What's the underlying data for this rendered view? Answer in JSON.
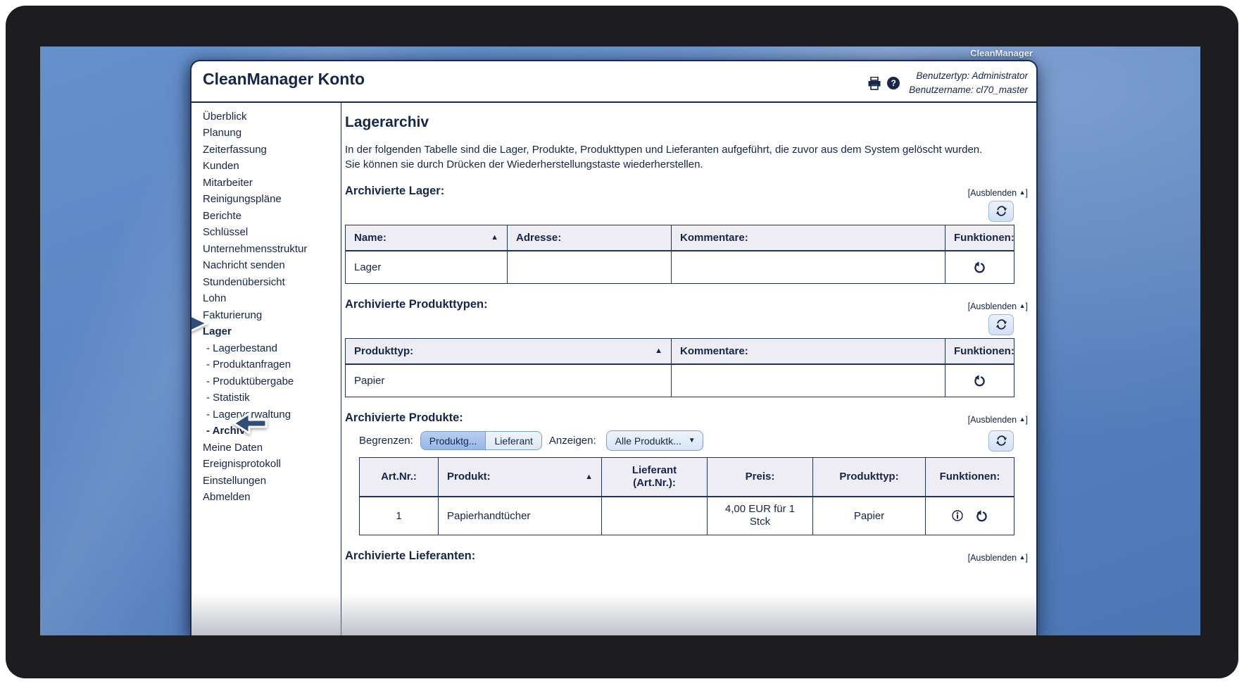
{
  "desktop": {
    "window_label": "CleanManager"
  },
  "colors": {
    "accent_navy": "#15264a",
    "desktop_blue": "#5b85c3",
    "table_header_bg": "#ededf3",
    "active_button_blue": "#a6c0ea",
    "bezel_black": "#1d1d1f"
  },
  "header": {
    "title": "CleanManager Konto",
    "help_glyph": "?",
    "user_type": "Benutzertyp: Administrator",
    "user_name": "Benutzername: cl70_master"
  },
  "sidebar": {
    "items": [
      {
        "label": "Überblick"
      },
      {
        "label": "Planung"
      },
      {
        "label": "Zeiterfassung"
      },
      {
        "label": "Kunden"
      },
      {
        "label": "Mitarbeiter"
      },
      {
        "label": "Reinigungspläne"
      },
      {
        "label": "Berichte"
      },
      {
        "label": "Schlüssel"
      },
      {
        "label": "Unternehmensstruktur"
      },
      {
        "label": "Nachricht senden"
      },
      {
        "label": "Stundenübersicht"
      },
      {
        "label": "Lohn"
      },
      {
        "label": "Fakturierung"
      },
      {
        "label": "Lager"
      },
      {
        "label": "- Lagerbestand"
      },
      {
        "label": "- Produktanfragen"
      },
      {
        "label": "- Produktübergabe"
      },
      {
        "label": "- Statistik"
      },
      {
        "label": "- Lagerverwaltung"
      },
      {
        "label": "- Archiv"
      },
      {
        "label": "Meine Daten"
      },
      {
        "label": "Ereignisprotokoll"
      },
      {
        "label": "Einstellungen"
      },
      {
        "label": "Abmelden"
      }
    ]
  },
  "main": {
    "title": "Lagerarchiv",
    "description_line1": "In der folgenden Tabelle sind die Lager, Produkte, Produkttypen und Lieferanten aufgeführt, die zuvor aus dem System gelöscht wurden.",
    "description_line2": "Sie können sie durch Drücken der Wiederherstellungstaste wiederherstellen.",
    "hide_link": {
      "text": "[Ausblenden",
      "arrow": "▲",
      "close": "]"
    },
    "icons": {
      "sort_asc": "▲",
      "dropdown_arrow": "▼"
    },
    "sections": {
      "lager": {
        "title": "Archivierte Lager:",
        "table": {
          "headers": {
            "name": "Name:",
            "adresse": "Adresse:",
            "kommentare": "Kommentare:",
            "funktionen": "Funktionen:"
          },
          "rows": [
            {
              "name": "Lager",
              "adresse": "",
              "kommentare": ""
            }
          ]
        }
      },
      "produkttypen": {
        "title": "Archivierte Produkttypen:",
        "table": {
          "headers": {
            "produkttyp": "Produkttyp:",
            "kommentare": "Kommentare:",
            "funktionen": "Funktionen:"
          },
          "rows": [
            {
              "produkttyp": "Papier",
              "kommentare": ""
            }
          ]
        }
      },
      "produkte": {
        "title": "Archivierte Produkte:",
        "filters": {
          "begrenzen_label": "Begrenzen:",
          "produktgruppe_button": "Produktg...",
          "lieferant_button": "Lieferant",
          "anzeigen_label": "Anzeigen:",
          "produktkategorie_select": "Alle Produktk..."
        },
        "table": {
          "headers": {
            "artnr": "Art.Nr.:",
            "produkt": "Produkt:",
            "lieferant_line1": "Lieferant",
            "lieferant_line2": "(Art.Nr.):",
            "preis": "Preis:",
            "produkttyp": "Produkttyp:",
            "funktionen": "Funktionen:"
          },
          "rows": [
            {
              "artnr": "1",
              "produkt": "Papierhandtücher",
              "lieferant": "",
              "preis": "4,00 EUR für 1 Stck",
              "produkttyp": "Papier"
            }
          ]
        }
      },
      "lieferanten": {
        "title": "Archivierte Lieferanten:"
      }
    }
  }
}
